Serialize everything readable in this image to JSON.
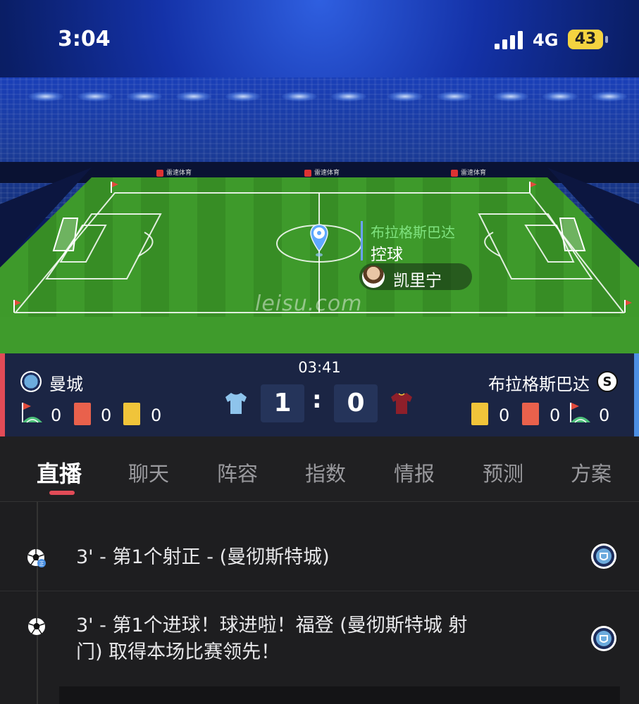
{
  "status_bar": {
    "time": "3:04",
    "network": "4G",
    "battery": "43"
  },
  "pitch": {
    "watermark": "leisu.com",
    "board_text": "雷速体育",
    "event": {
      "team": "布拉格斯巴达",
      "action": "控球",
      "player": "凯里宁"
    }
  },
  "match": {
    "clock": "03:41",
    "home": {
      "name": "曼城",
      "score": "1",
      "corners": "0",
      "red_cards": "0",
      "yellow_cards": "0"
    },
    "away": {
      "name": "布拉格斯巴达",
      "badge_letter": "S",
      "score": "0",
      "corners": "0",
      "red_cards": "0",
      "yellow_cards": "0"
    },
    "colon": ":"
  },
  "tabs": [
    {
      "label": "直播",
      "active": true
    },
    {
      "label": "聊天"
    },
    {
      "label": "阵容"
    },
    {
      "label": "指数"
    },
    {
      "label": "情报"
    },
    {
      "label": "预测"
    },
    {
      "label": "方案"
    }
  ],
  "feed": [
    {
      "icon": "shot-on-target-icon",
      "text": "3' - 第1个射正 - (曼彻斯特城)"
    },
    {
      "icon": "goal-ball-icon",
      "line1": "3' - 第1个进球！球进啦！福登 (曼彻斯特城 射",
      "line2": "门) 取得本场比赛领先！"
    }
  ],
  "colors": {
    "home_accent": "#e24b57",
    "away_accent": "#4c8fe3",
    "pitch_green": "#3f9b2c",
    "tab_active_underline": "#e24b57"
  }
}
